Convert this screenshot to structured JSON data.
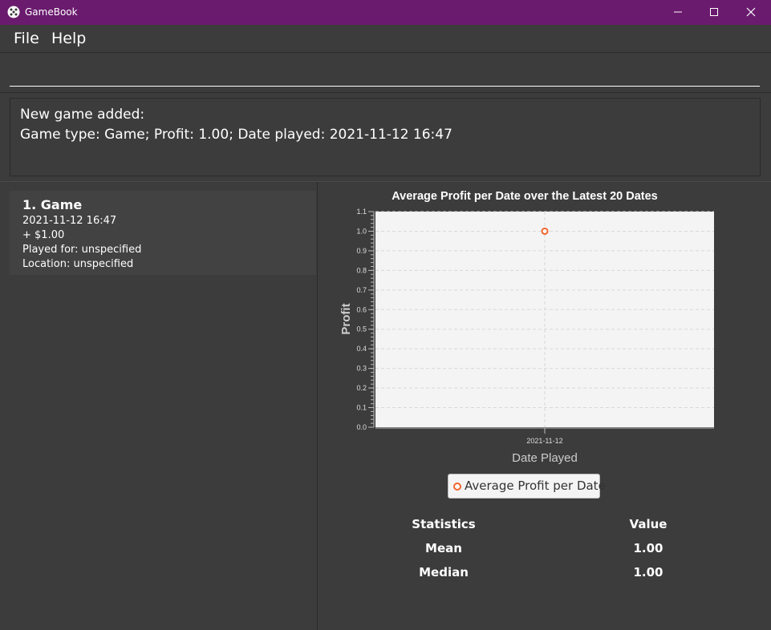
{
  "window": {
    "title": "GameBook",
    "icon": "dice-icon",
    "controls": [
      "minimize-icon",
      "maximize-icon",
      "close-icon"
    ],
    "titlebar_color": "#6a1b6e"
  },
  "menu": {
    "file": "File",
    "help": "Help"
  },
  "command": {
    "value": "",
    "placeholder": ""
  },
  "result": {
    "line1": "New game added:",
    "line2": "Game type: Game; Profit: 1.00; Date played: 2021-11-12 16:47"
  },
  "games": [
    {
      "title": "1.  Game",
      "datetime": "2021-11-12 16:47",
      "profit": "+ $1.00",
      "played_for": "Played for: unspecified",
      "location": "Location: unspecified"
    }
  ],
  "chart_data": {
    "type": "line",
    "title": "Average Profit per Date over the Latest 20 Dates",
    "xlabel": "Date Played",
    "ylabel": "Profit",
    "categories": [
      "2021-11-12"
    ],
    "series": [
      {
        "name": "Average Profit per Date",
        "values": [
          1.0
        ],
        "color": "#f3622d"
      }
    ],
    "ylim": [
      0,
      1.1
    ],
    "yticks": [
      "0.0",
      "0.1",
      "0.2",
      "0.3",
      "0.4",
      "0.5",
      "0.6",
      "0.7",
      "0.8",
      "0.9",
      "1.0",
      "1.1"
    ],
    "grid": true,
    "legend": "bottom"
  },
  "stats": {
    "headers": {
      "name": "Statistics",
      "value": "Value"
    },
    "rows": [
      {
        "name": "Mean",
        "value": "1.00"
      },
      {
        "name": "Median",
        "value": "1.00"
      }
    ]
  }
}
